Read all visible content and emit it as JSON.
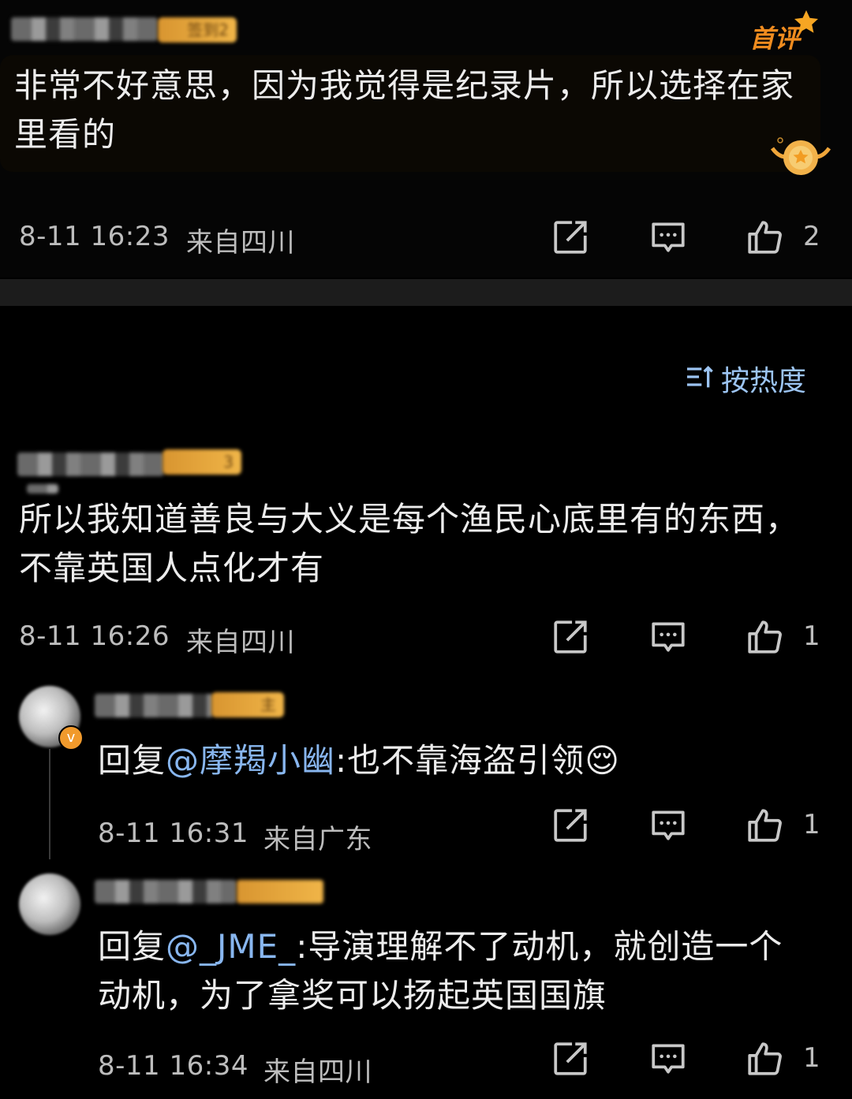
{
  "top_comment": {
    "badge": "签到2",
    "tag": "首评",
    "content": "非常不好意思，因为我觉得是纪录片，所以选择在家里看的",
    "timestamp": "8-11 16:23",
    "location": "来自四川",
    "likes": "2"
  },
  "sort": {
    "label": "按热度",
    "icon": "sort-icon"
  },
  "comment": {
    "badge": "3",
    "content": "所以我知道善良与大义是每个渔民心底里有的东西，不靠英国人点化才有",
    "timestamp": "8-11 16:26",
    "location": "来自四川",
    "likes": "1"
  },
  "replies": [
    {
      "badge": "主",
      "prefix": "回复",
      "mention": "@摩羯小幽",
      "text": ":也不靠海盗引领",
      "emoji": "😌",
      "timestamp": "8-11 16:31",
      "location": "来自广东",
      "likes": "1"
    },
    {
      "prefix": "回复",
      "mention": "@_JME_",
      "text": ":导演理解不了动机，就创造一个动机，为了拿奖可以扬起英国国旗",
      "timestamp": "8-11 16:34",
      "location": "来自四川",
      "likes": "1"
    }
  ],
  "colors": {
    "background": "#000000",
    "mention": "#88b6ef",
    "sort": "#9cc4f2",
    "badge": "#f0b548"
  }
}
